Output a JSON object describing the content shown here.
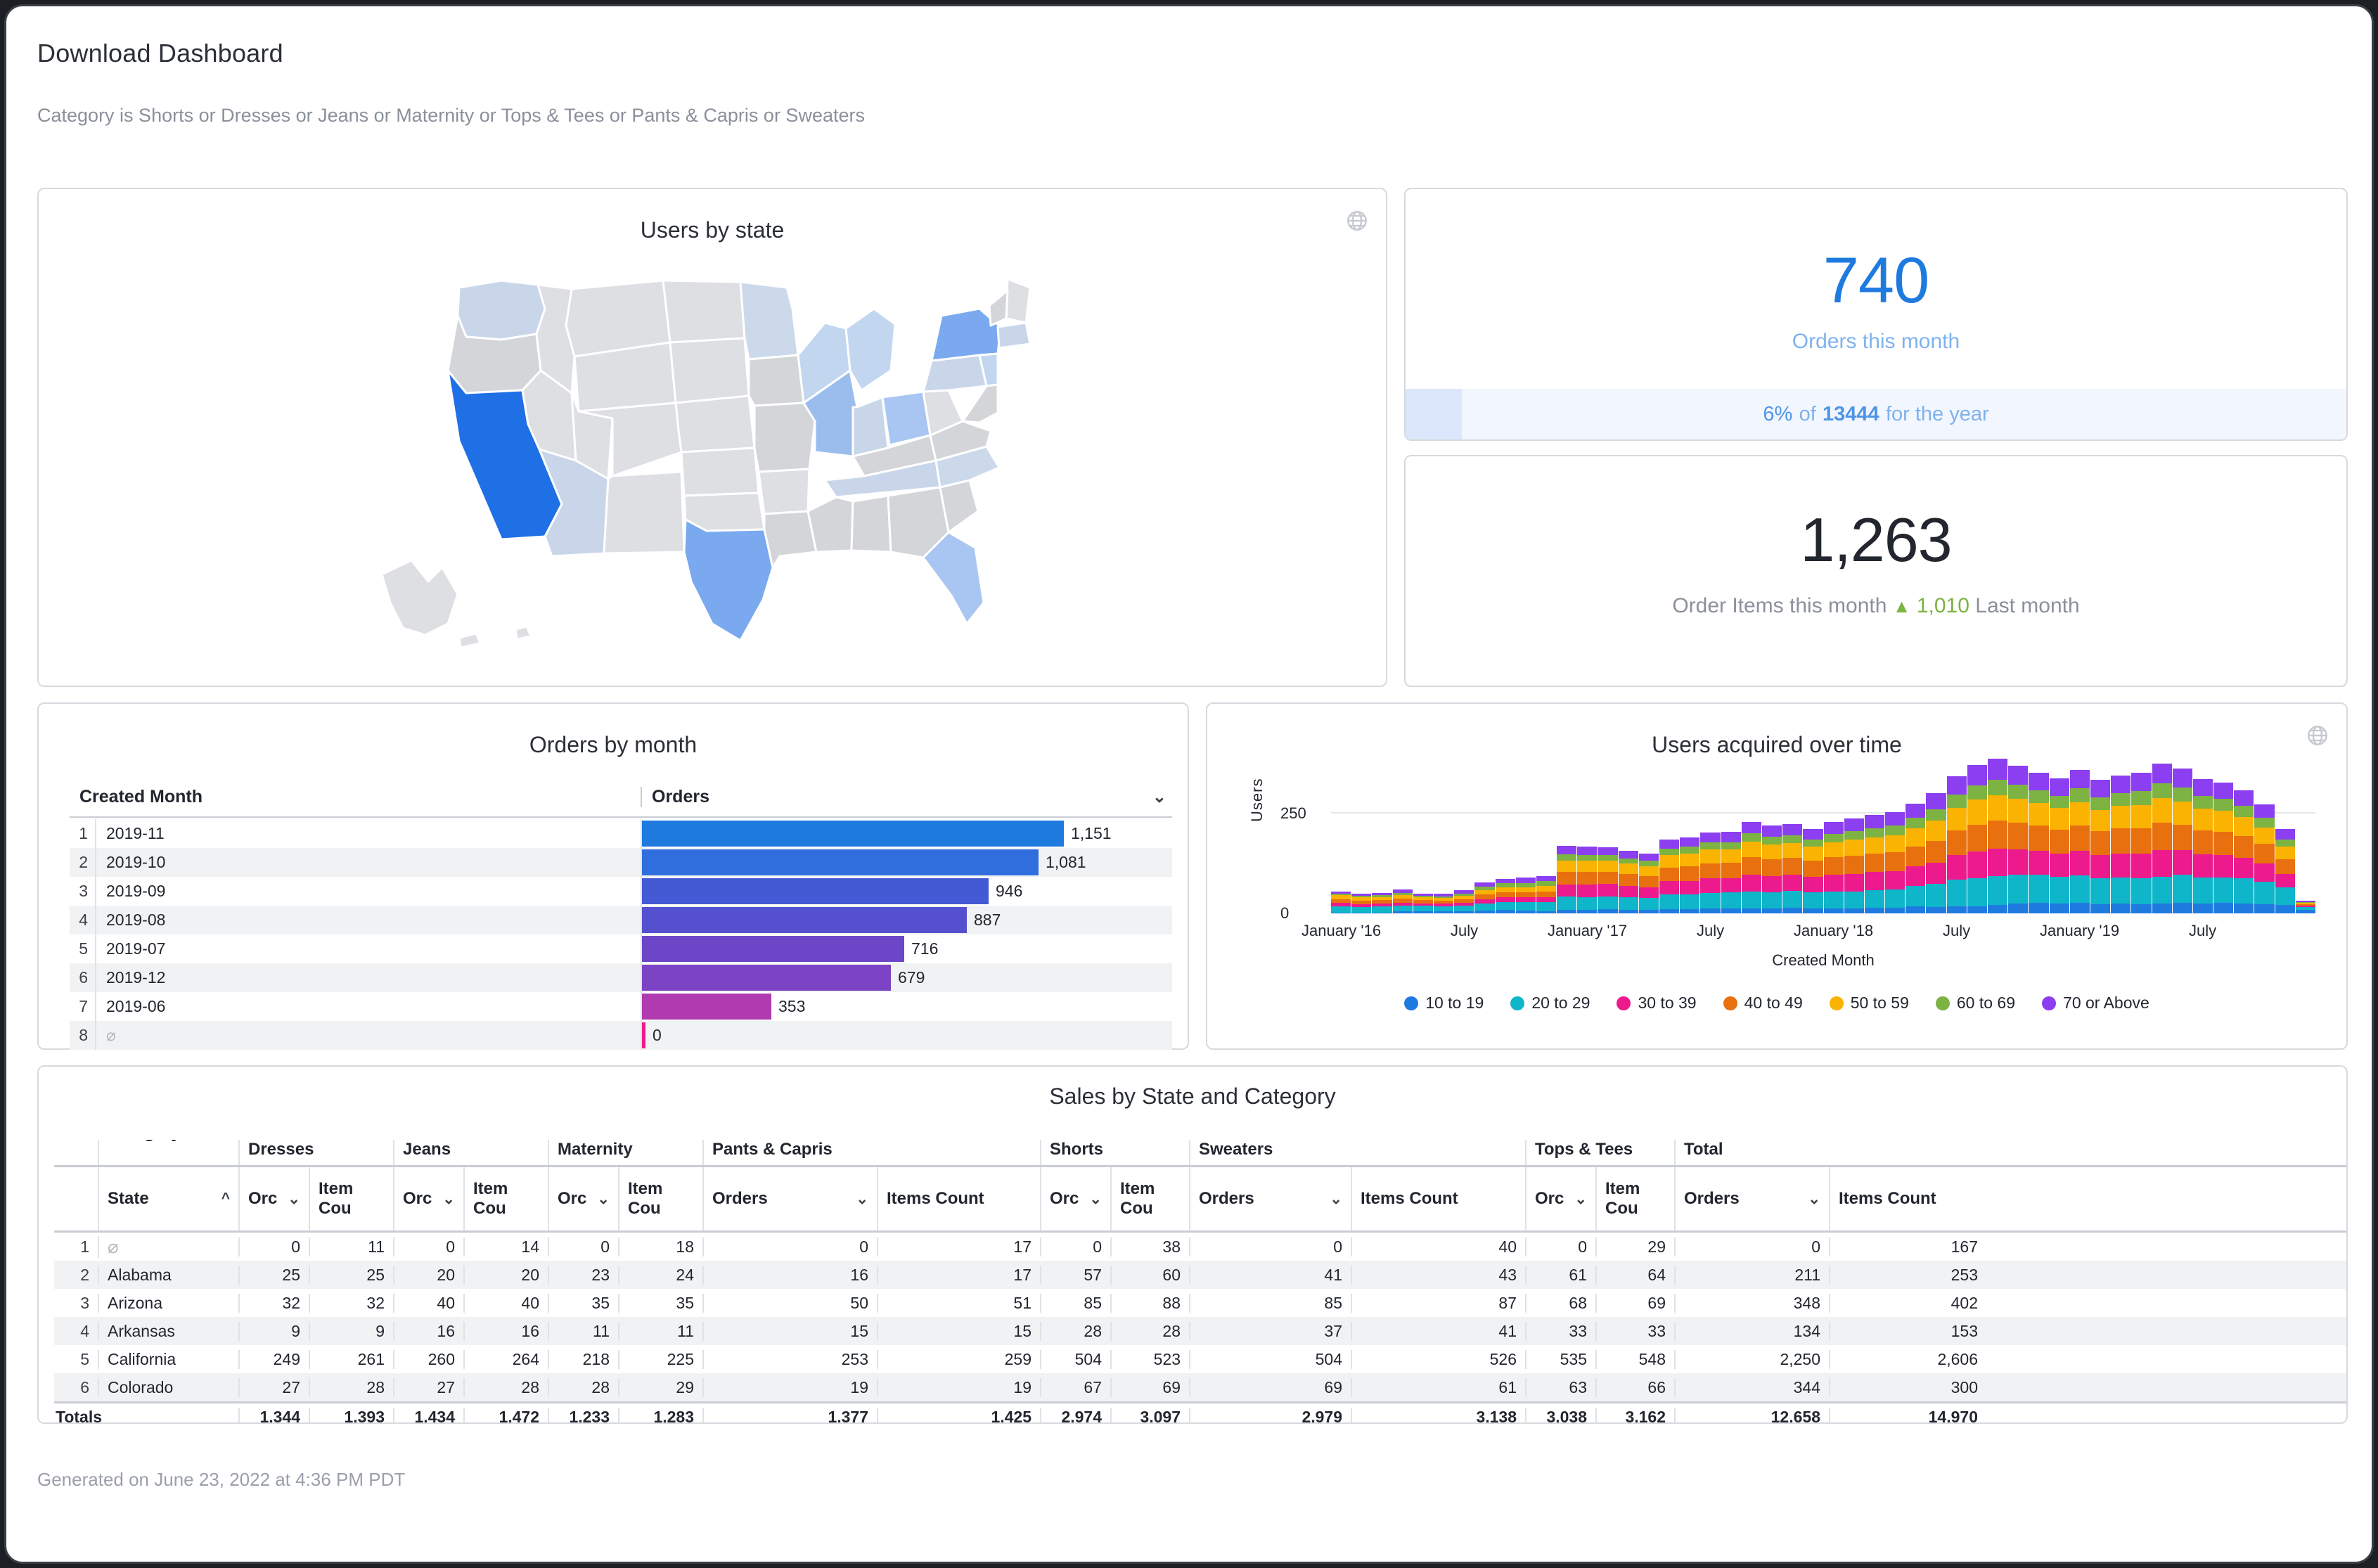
{
  "header": {
    "title": "Download Dashboard",
    "filter_text": "Category is Shorts or Dresses or Jeans or Maternity or Tops & Tees or Pants & Capris or Sweaters"
  },
  "footer": {
    "generated": "Generated on June 23, 2022 at 4:36 PM PDT"
  },
  "map_tile": {
    "title": "Users by state",
    "icon": "globe-icon",
    "legend_note": "",
    "states_highlighted": [
      {
        "state": "California",
        "level": "highest",
        "color": "#1f6fe5"
      },
      {
        "state": "Texas",
        "level": "high",
        "color": "#7aa9ef"
      },
      {
        "state": "New York",
        "level": "high",
        "color": "#7aa9ef"
      },
      {
        "state": "Illinois",
        "level": "medium",
        "color": "#a9c6f2"
      },
      {
        "state": "Florida",
        "level": "medium",
        "color": "#a9c6f2"
      },
      {
        "state": "Ohio",
        "level": "medium-low",
        "color": "#c3d6f0"
      },
      {
        "state": "Other states",
        "level": "low",
        "color": "#dddfe2"
      }
    ]
  },
  "kpi_orders": {
    "value": "740",
    "label": "Orders this month",
    "progress_pct_text": "6%",
    "progress_of_text": "of",
    "progress_total": "13444",
    "progress_suffix": "for the year",
    "progress_fill_percent": 6,
    "accent_color": "#1f7ae0"
  },
  "kpi_order_items": {
    "value": "1,263",
    "label_prefix": "Order Items this month",
    "delta_triangle": "▲",
    "delta_value": "1,010",
    "label_suffix": "Last month",
    "delta_color": "#7cb342"
  },
  "orders_by_month": {
    "title": "Orders by month",
    "columns": [
      "Created Month",
      "Orders"
    ],
    "sort_icon": "chevron-down-icon",
    "null_glyph": "⌀",
    "rows": [
      {
        "n": "1",
        "month": "2019-11",
        "orders": "1,151",
        "value": 1151,
        "color": "#1f7ae0"
      },
      {
        "n": "2",
        "month": "2019-10",
        "orders": "1,081",
        "value": 1081,
        "color": "#2f6edc"
      },
      {
        "n": "3",
        "month": "2019-09",
        "orders": "946",
        "value": 946,
        "color": "#4459d4"
      },
      {
        "n": "4",
        "month": "2019-08",
        "orders": "887",
        "value": 887,
        "color": "#5450cf"
      },
      {
        "n": "5",
        "month": "2019-07",
        "orders": "716",
        "value": 716,
        "color": "#6d46c8"
      },
      {
        "n": "6",
        "month": "2019-12",
        "orders": "679",
        "value": 679,
        "color": "#7c43c4"
      },
      {
        "n": "7",
        "month": "2019-06",
        "orders": "353",
        "value": 353,
        "color": "#b03aaf"
      },
      {
        "n": "8",
        "month": "⌀",
        "orders": "0",
        "value": 0,
        "color": "#ec1a8d"
      }
    ]
  },
  "chart_data": {
    "type": "bar",
    "title": "Users acquired over time",
    "xlabel": "Created Month",
    "ylabel": "Users",
    "ylim": [
      0,
      330
    ],
    "yticks": [
      "0",
      "250"
    ],
    "grid": true,
    "legend_position": "bottom",
    "stacked": true,
    "icon": "globe-icon",
    "xtick_labels": [
      "January '16",
      "July",
      "January '17",
      "July",
      "January '18",
      "July",
      "January '19",
      "July"
    ],
    "xtick_indices": [
      0,
      6,
      12,
      18,
      24,
      30,
      36,
      42
    ],
    "series": [
      {
        "name": "10 to 19",
        "color": "#1f7ae0",
        "values": [
          2,
          2,
          2,
          5,
          6,
          5,
          5,
          7,
          8,
          7,
          6,
          8,
          9,
          10,
          9,
          9,
          11,
          11,
          12,
          12,
          13,
          12,
          14,
          13,
          13,
          13,
          14,
          14,
          17,
          16,
          18,
          18,
          21,
          24,
          27,
          25,
          26,
          23,
          24,
          22,
          24,
          26,
          24,
          26,
          25,
          23,
          21,
          8
        ]
      },
      {
        "name": "20 to 29",
        "color": "#0fb5c9",
        "values": [
          16,
          14,
          15,
          14,
          13,
          13,
          15,
          18,
          20,
          21,
          22,
          34,
          32,
          33,
          31,
          30,
          37,
          36,
          39,
          40,
          42,
          41,
          42,
          40,
          41,
          42,
          44,
          45,
          52,
          58,
          66,
          70,
          72,
          72,
          70,
          66,
          68,
          64,
          66,
          65,
          68,
          70,
          66,
          64,
          62,
          56,
          44,
          7
        ]
      },
      {
        "name": "30 to 39",
        "color": "#ec1a8d",
        "values": [
          8,
          7,
          7,
          8,
          6,
          6,
          7,
          10,
          12,
          12,
          13,
          30,
          31,
          30,
          28,
          26,
          32,
          34,
          36,
          36,
          42,
          40,
          40,
          38,
          42,
          44,
          45,
          46,
          48,
          52,
          62,
          66,
          68,
          64,
          60,
          58,
          62,
          58,
          60,
          62,
          66,
          62,
          58,
          56,
          52,
          46,
          34,
          4
        ]
      },
      {
        "name": "40 to 49",
        "color": "#e8700f",
        "values": [
          10,
          9,
          9,
          10,
          8,
          8,
          9,
          12,
          13,
          13,
          14,
          32,
          32,
          31,
          30,
          28,
          35,
          36,
          38,
          38,
          44,
          42,
          42,
          40,
          44,
          45,
          46,
          48,
          50,
          55,
          62,
          68,
          70,
          66,
          62,
          60,
          64,
          60,
          62,
          64,
          68,
          64,
          60,
          58,
          54,
          48,
          36,
          4
        ]
      },
      {
        "name": "50 to 59",
        "color": "#fbb302",
        "values": [
          9,
          8,
          8,
          9,
          7,
          7,
          8,
          11,
          12,
          12,
          13,
          28,
          28,
          27,
          26,
          25,
          31,
          32,
          34,
          34,
          38,
          37,
          37,
          35,
          38,
          40,
          41,
          42,
          45,
          50,
          56,
          62,
          64,
          60,
          56,
          54,
          58,
          54,
          56,
          58,
          62,
          58,
          54,
          52,
          48,
          42,
          32,
          4
        ]
      },
      {
        "name": "60 to 69",
        "color": "#7cb342",
        "values": [
          4,
          4,
          4,
          5,
          4,
          4,
          6,
          9,
          10,
          11,
          12,
          15,
          14,
          14,
          13,
          13,
          16,
          17,
          18,
          18,
          21,
          20,
          20,
          19,
          21,
          22,
          23,
          24,
          26,
          29,
          33,
          36,
          38,
          35,
          32,
          31,
          34,
          31,
          32,
          34,
          36,
          34,
          31,
          30,
          28,
          24,
          18,
          2
        ]
      },
      {
        "name": "70 or Above",
        "color": "#8b3ff0",
        "values": [
          6,
          6,
          6,
          8,
          6,
          6,
          8,
          11,
          12,
          13,
          14,
          21,
          20,
          20,
          19,
          18,
          23,
          24,
          25,
          25,
          29,
          28,
          28,
          26,
          29,
          31,
          32,
          33,
          36,
          40,
          46,
          50,
          53,
          48,
          45,
          43,
          47,
          43,
          45,
          47,
          50,
          47,
          43,
          41,
          38,
          33,
          25,
          3
        ]
      }
    ]
  },
  "sales_table": {
    "title": "Sales by State and Category",
    "category_label": "Category",
    "group_headers": [
      "Dresses",
      "Jeans",
      "Maternity",
      "Pants & Capris",
      "Shorts",
      "Sweaters",
      "Tops & Tees",
      "Total"
    ],
    "state_header": "State",
    "state_sort_icon": "chevron-up-icon",
    "sub_headers_full": [
      "Orders",
      "Items Count"
    ],
    "sub_headers_truncated": [
      "Orс",
      "Item Cou"
    ],
    "sort_icon": "chevron-down-icon",
    "null_glyph": "⌀",
    "column_layout": [
      {
        "group": "Dresses",
        "orders_label": "Orс",
        "items_label": "Item Cou",
        "orders_truncated": true,
        "items_truncated": true
      },
      {
        "group": "Jeans",
        "orders_label": "Orс",
        "items_label": "Item Cou",
        "orders_truncated": true,
        "items_truncated": true
      },
      {
        "group": "Maternity",
        "orders_label": "Orс",
        "items_label": "Item Cou",
        "orders_truncated": true,
        "items_truncated": true
      },
      {
        "group": "Pants & Capris",
        "orders_label": "Orders",
        "items_label": "Items Count",
        "orders_truncated": false,
        "items_truncated": false
      },
      {
        "group": "Shorts",
        "orders_label": "Orс",
        "items_label": "Item Cou",
        "orders_truncated": true,
        "items_truncated": true
      },
      {
        "group": "Sweaters",
        "orders_label": "Orders",
        "items_label": "Items Count",
        "orders_truncated": false,
        "items_truncated": false
      },
      {
        "group": "Tops & Tees",
        "orders_label": "Orс",
        "items_label": "Item Cou",
        "orders_truncated": true,
        "items_truncated": true
      },
      {
        "group": "Total",
        "orders_label": "Orders",
        "items_label": "Items Count",
        "orders_truncated": false,
        "items_truncated": false
      }
    ],
    "rows": [
      {
        "n": "1",
        "state": "⌀",
        "state_is_null": true,
        "cells": [
          "0",
          "11",
          "0",
          "14",
          "0",
          "18",
          "0",
          "17",
          "0",
          "38",
          "0",
          "40",
          "0",
          "29",
          "0",
          "167"
        ]
      },
      {
        "n": "2",
        "state": "Alabama",
        "state_is_null": false,
        "cells": [
          "25",
          "25",
          "20",
          "20",
          "23",
          "24",
          "16",
          "17",
          "57",
          "60",
          "41",
          "43",
          "61",
          "64",
          "211",
          "253"
        ]
      },
      {
        "n": "3",
        "state": "Arizona",
        "state_is_null": false,
        "cells": [
          "32",
          "32",
          "40",
          "40",
          "35",
          "35",
          "50",
          "51",
          "85",
          "88",
          "85",
          "87",
          "68",
          "69",
          "348",
          "402"
        ]
      },
      {
        "n": "4",
        "state": "Arkansas",
        "state_is_null": false,
        "cells": [
          "9",
          "9",
          "16",
          "16",
          "11",
          "11",
          "15",
          "15",
          "28",
          "28",
          "37",
          "41",
          "33",
          "33",
          "134",
          "153"
        ]
      },
      {
        "n": "5",
        "state": "California",
        "state_is_null": false,
        "cells": [
          "249",
          "261",
          "260",
          "264",
          "218",
          "225",
          "253",
          "259",
          "504",
          "523",
          "504",
          "526",
          "535",
          "548",
          "2,250",
          "2,606"
        ]
      },
      {
        "n": "6",
        "state": "Colorado",
        "state_is_null": false,
        "cells": [
          "27",
          "28",
          "27",
          "28",
          "28",
          "29",
          "19",
          "19",
          "67",
          "69",
          "69",
          "61",
          "63",
          "66",
          "344",
          "300"
        ]
      }
    ],
    "totals_label": "Totals",
    "totals": [
      "1,344",
      "1,393",
      "1,434",
      "1,472",
      "1,233",
      "1,283",
      "1,377",
      "1,425",
      "2,974",
      "3,097",
      "2,979",
      "3,138",
      "3,038",
      "3,162",
      "12,658",
      "14,970"
    ]
  }
}
